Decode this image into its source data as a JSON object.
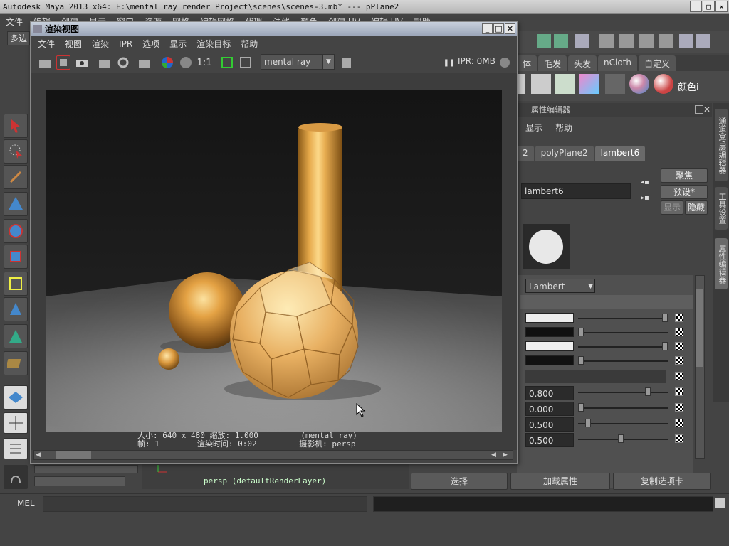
{
  "main_title": "Autodesk Maya 2013 x64: E:\\mental ray render_Project\\scenes\\scenes-3.mb*   ---   pPlane2",
  "main_menu": [
    "文件",
    "编辑",
    "创建",
    "显示",
    "窗口",
    "资源",
    "网格",
    "编辑网格",
    "代理",
    "法线",
    "颜色",
    "创建 UV",
    "编辑 UV",
    "帮助"
  ],
  "status_line": {
    "mode": "多边"
  },
  "shelf_tabs": [
    "体",
    "毛发",
    "头发",
    "nCloth",
    "自定义"
  ],
  "shelf_last_label": "颜色i",
  "attribute_editor": {
    "header": "属性编辑器",
    "menu": [
      "显示",
      "帮助"
    ],
    "tabs": [
      "2",
      "polyPlane2",
      "lambert6"
    ],
    "active_tab": "lambert6",
    "node_name": "lambert6",
    "buttons": {
      "focus": "聚焦",
      "presets": "预设*",
      "show": "显示",
      "hide": "隐藏"
    },
    "type": "Lambert",
    "values": {
      "v1": "0.800",
      "v2": "0.000",
      "v3": "0.500",
      "v4": "0.500"
    }
  },
  "side_tabs": [
    "通道盒/层编辑器",
    "工具设置",
    "属性编辑器"
  ],
  "render_view": {
    "title": "渲染视图",
    "menu": [
      "文件",
      "视图",
      "渲染",
      "IPR",
      "选项",
      "显示",
      "渲染目标",
      "帮助"
    ],
    "ratio_label": "1:1",
    "renderer": "mental ray",
    "ipr_status": "IPR: 0MB",
    "info_line1": "大小: 640 x 480 缩放: 1.000         (mental ray)",
    "info_line2": "帧: 1        渲染时间: 0:02         摄影机: persp"
  },
  "viewport_label": "persp (defaultRenderLayer)",
  "bottom_buttons": {
    "select": "选择",
    "load_attributes": "加载属性",
    "copy_tab": "复制选项卡"
  },
  "cmd_label": "MEL",
  "colors": {
    "gold": "#e0a850",
    "floor": "#8a8a8a",
    "bg": "#1a1a1a"
  }
}
